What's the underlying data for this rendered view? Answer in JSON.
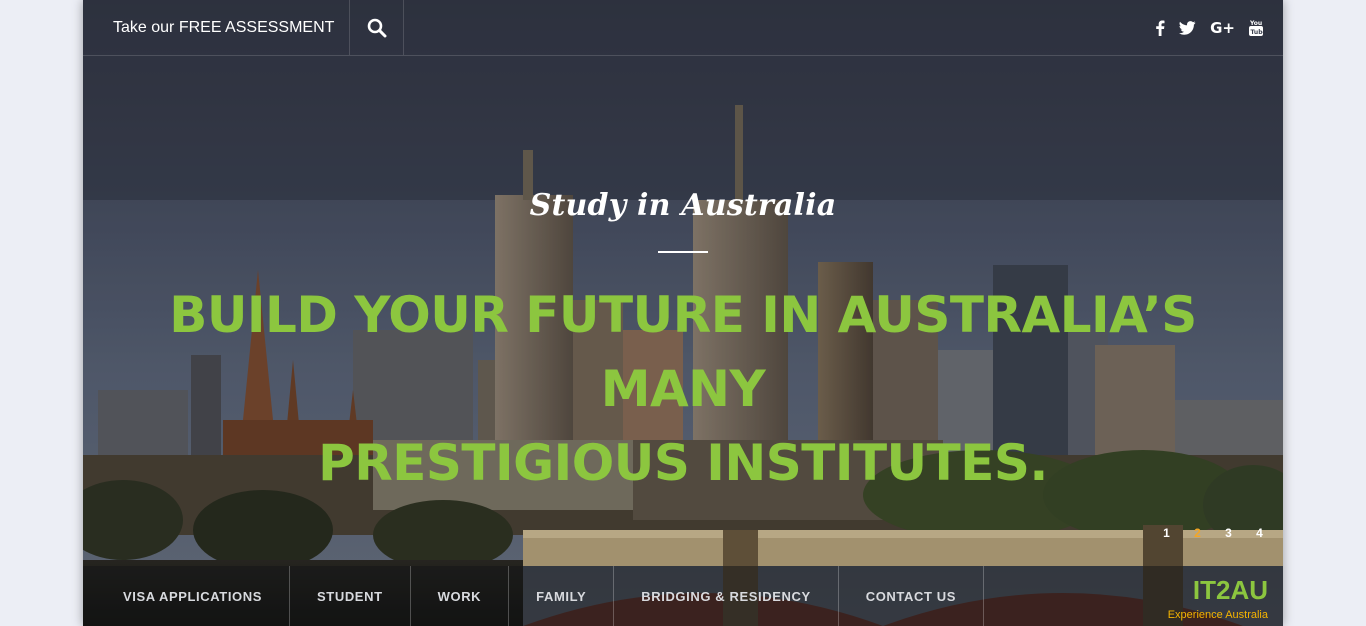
{
  "topbar": {
    "assessment_label": "Take our FREE ASSESSMENT",
    "search_icon": "search-icon",
    "social": [
      {
        "name": "facebook-icon",
        "glyph": "f"
      },
      {
        "name": "twitter-icon",
        "glyph": "t"
      },
      {
        "name": "google-plus-icon",
        "glyph": "G+"
      },
      {
        "name": "youtube-icon",
        "glyph": "You"
      }
    ]
  },
  "hero": {
    "script_title": "Study in Australia",
    "headline_line1": "BUILD YOUR FUTURE IN AUSTRALIA’S MANY",
    "headline_line2": "PRESTIGIOUS INSTITUTES."
  },
  "pager": {
    "items": [
      "1",
      "2",
      "3",
      "4"
    ],
    "active": "2"
  },
  "nav": {
    "items": [
      "VISA APPLICATIONS",
      "STUDENT",
      "WORK",
      "FAMILY",
      "BRIDGING & RESIDENCY",
      "CONTACT US"
    ]
  },
  "brand": {
    "name": "IT2AU",
    "tagline": "Experience Australia"
  },
  "colors": {
    "accent_green": "#8cc63f",
    "accent_orange": "#f5a623",
    "page_bg": "#eceef5"
  }
}
